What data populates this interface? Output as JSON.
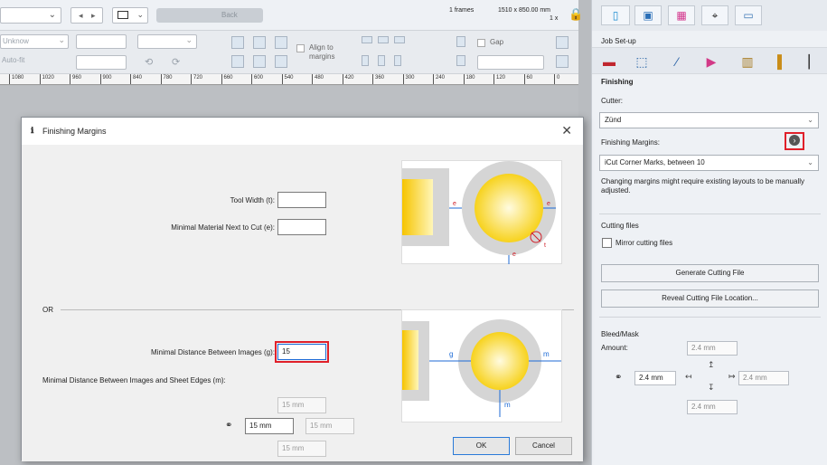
{
  "toolbar": {
    "frames": "1 frames",
    "dimensions": "1510 x 850.00 mm",
    "scale": "1 x",
    "size_mode": "Unknow",
    "fit_mode": "Auto-fit",
    "disabled_button": "Back",
    "align_label_1": "Align to",
    "align_label_2": "margins",
    "gap_label": "Gap"
  },
  "ruler": [
    "1080",
    "1020",
    "960",
    "900",
    "840",
    "780",
    "720",
    "660",
    "600",
    "540",
    "480",
    "420",
    "360",
    "300",
    "240",
    "180",
    "120",
    "60",
    "0"
  ],
  "dialog": {
    "title": "Finishing Margins",
    "icon": "ℹ",
    "close": "✕",
    "tool_width_label": "Tool Width (t):",
    "tool_width_value": "",
    "min_material_label": "Minimal Material Next to Cut (e):",
    "min_material_value": "",
    "or_label": "OR",
    "min_distance_label": "Minimal Distance Between Images (g):",
    "min_distance_value": "15",
    "min_sheet_label": "Minimal Distance Between Images and Sheet Edges (m):",
    "top_value": "15 mm",
    "left_value": "15 mm",
    "right_value": "15 mm",
    "bottom_value": "15 mm",
    "link_icon": "link-icon",
    "ok": "OK",
    "cancel": "Cancel",
    "illus_labels": {
      "e": "e",
      "t": "t",
      "g": "g",
      "m": "m"
    }
  },
  "panel": {
    "job_setup": "Job Set-up",
    "section": "Finishing",
    "cutter_label": "Cutter:",
    "cutter_value": "Zünd",
    "margins_label": "Finishing Margins:",
    "margins_value": "iCut Corner Marks, between 10",
    "warning": "Changing margins might require existing layouts to be manually adjusted.",
    "cutting_files": "Cutting files",
    "mirror": "Mirror cutting files",
    "generate": "Generate Cutting File",
    "reveal": "Reveal Cutting File Location...",
    "bleed": "Bleed/Mask",
    "amount": "Amount:",
    "bleed_top": "2.4 mm",
    "bleed_left": "2.4 mm",
    "bleed_right": "2.4 mm",
    "bleed_bottom": "2.4 mm"
  },
  "colors": {
    "highlight": "#e0202a",
    "accent": "#1c6ad6",
    "circle_yellow": "#f7d21c"
  }
}
